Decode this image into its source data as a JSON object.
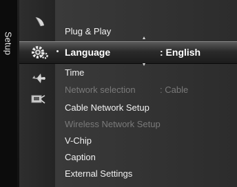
{
  "side_tab": {
    "label": "Setup"
  },
  "category_icons": [
    "satellite-dish-icon",
    "gear-icon",
    "airplane-icon",
    "network-plug-icon"
  ],
  "menu": {
    "items": [
      {
        "label": "Plug & Play",
        "value": "",
        "enabled": true,
        "selected": false
      },
      {
        "label": "Language",
        "value": ": English",
        "enabled": true,
        "selected": true
      },
      {
        "label": "Time",
        "value": "",
        "enabled": true,
        "selected": false
      },
      {
        "label": "Network selection",
        "value": ": Cable",
        "enabled": false,
        "selected": false
      },
      {
        "label": "Cable Network Setup",
        "value": "",
        "enabled": true,
        "selected": false
      },
      {
        "label": "Wireless Network Setup",
        "value": "",
        "enabled": false,
        "selected": false
      },
      {
        "label": "V-Chip",
        "value": "",
        "enabled": true,
        "selected": false
      },
      {
        "label": "Caption",
        "value": "",
        "enabled": true,
        "selected": false
      },
      {
        "label": "External Settings",
        "value": "",
        "enabled": true,
        "selected": false
      }
    ]
  },
  "colors": {
    "highlight_text": "#ffffff",
    "disabled_text": "#7a7a7a",
    "normal_text": "#f2f2f2"
  }
}
